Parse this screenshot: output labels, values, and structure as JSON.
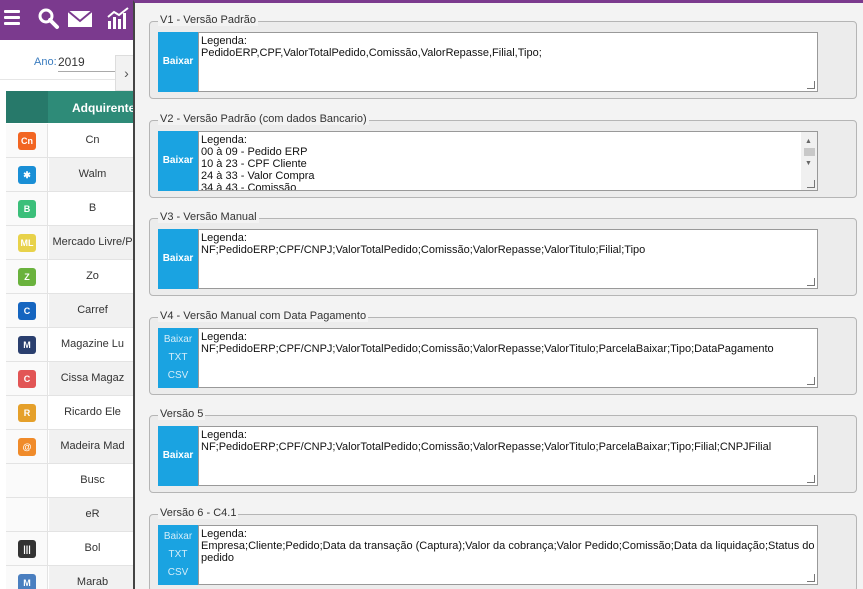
{
  "app": {
    "ano_label": "Ano:",
    "ano_value": "2019",
    "table_header": "Adquirente",
    "collapse_icon": "chevron-right-icon",
    "rows": [
      {
        "name": "Cn",
        "logo_text": "Cn",
        "logo_color": "#f26522"
      },
      {
        "name": "Walm",
        "logo_text": "✱",
        "logo_color": "#1a8fd6"
      },
      {
        "name": "B",
        "logo_text": "B",
        "logo_color": "#3bbf7a"
      },
      {
        "name": "Mercado Livre/P",
        "logo_text": "ML",
        "logo_color": "#e8d24a"
      },
      {
        "name": "Zo",
        "logo_text": "Z",
        "logo_color": "#6ab23d"
      },
      {
        "name": "Carref",
        "logo_text": "C",
        "logo_color": "#1565c0"
      },
      {
        "name": "Magazine Lu",
        "logo_text": "M",
        "logo_color": "#2a3f6e"
      },
      {
        "name": "Cissa Magaz",
        "logo_text": "C",
        "logo_color": "#e25555"
      },
      {
        "name": "Ricardo Ele",
        "logo_text": "R",
        "logo_color": "#e5a02a"
      },
      {
        "name": "Madeira Mad",
        "logo_text": "@",
        "logo_color": "#f08b2a"
      },
      {
        "name": "Busc",
        "logo_text": "",
        "logo_color": "#fafafa"
      },
      {
        "name": "eR",
        "logo_text": "",
        "logo_color": "#fafafa"
      },
      {
        "name": "Bol",
        "logo_text": "|||",
        "logo_color": "#333333"
      },
      {
        "name": "Marab",
        "logo_text": "M",
        "logo_color": "#4a7fc0"
      }
    ]
  },
  "versions": [
    {
      "legend": "V1 - Versão Padrão",
      "buttons": [
        "Baixar"
      ],
      "text": "Legenda:\nPedidoERP,CPF,ValorTotalPedido,Comissão,ValorRepasse,Filial,Tipo;",
      "scroll": false
    },
    {
      "legend": "V2 - Versão Padrão (com dados Bancario)",
      "buttons": [
        "Baixar"
      ],
      "text": "Legenda:\n00 à 09 - Pedido ERP\n10 à 23 - CPF Cliente\n24 à 33 - Valor Compra\n34 à 43 - Comissão",
      "scroll": true
    },
    {
      "legend": "V3 - Versão Manual",
      "buttons": [
        "Baixar"
      ],
      "text": "Legenda:\nNF;PedidoERP;CPF/CNPJ;ValorTotalPedido;Comissão;ValorRepasse;ValorTitulo;Filial;Tipo",
      "scroll": false
    },
    {
      "legend": "V4 - Versão Manual com Data Pagamento",
      "buttons": [
        "Baixar",
        "TXT",
        "CSV"
      ],
      "text": "Legenda:\nNF;PedidoERP;CPF/CNPJ;ValorTotalPedido;Comissão;ValorRepasse;ValorTitulo;ParcelaBaixar;Tipo;DataPagamento",
      "scroll": false
    },
    {
      "legend": "Versão 5",
      "buttons": [
        "Baixar"
      ],
      "text": "Legenda:\nNF;PedidoERP;CPF/CNPJ;ValorTotalPedido;Comissão;ValorRepasse;ValorTitulo;ParcelaBaixar;Tipo;Filial;CNPJFilial",
      "scroll": false
    },
    {
      "legend": "Versão 6 - C4.1",
      "buttons": [
        "Baixar",
        "TXT",
        "CSV"
      ],
      "text": "Legenda:\nEmpresa;Cliente;Pedido;Data da transação (Captura);Valor da cobrança;Valor Pedido;Comissão;Data da liquidação;Status do pedido",
      "scroll": false
    }
  ],
  "colors": {
    "accent": "#7b3a8e",
    "button": "#1aa3e1",
    "table_header": "#2e8b78"
  }
}
